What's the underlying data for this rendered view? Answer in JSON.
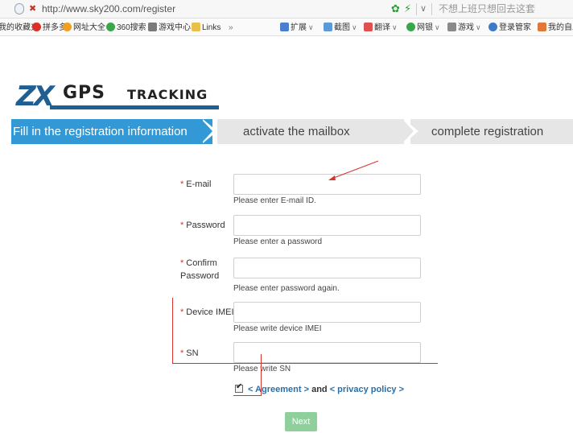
{
  "browser": {
    "url": "http://www.sky200.com/register",
    "search_text": "不想上班只想回去这套"
  },
  "favorites": [
    {
      "label": "我的收藏夹",
      "color": "#e8e8e8"
    },
    {
      "label": "拼多多",
      "color": "#e02e24"
    },
    {
      "label": "网址大全",
      "color": "#f0a020"
    },
    {
      "label": "360搜索",
      "color": "#3aa64a"
    },
    {
      "label": "游戏中心",
      "color": "#7a7a7a"
    },
    {
      "label": "Links",
      "color": "#e8c04a"
    },
    {
      "label": "»",
      "color": ""
    },
    {
      "label": "扩展",
      "color": "#4a7fd0"
    },
    {
      "label": "截图",
      "color": "#5a9ad8"
    },
    {
      "label": "翻译",
      "color": "#e05050"
    },
    {
      "label": "网银",
      "color": "#3aa64a"
    },
    {
      "label": "游戏",
      "color": "#8a8a8a"
    },
    {
      "label": "登录管家",
      "color": "#3d7ac8"
    },
    {
      "label": "我的自助",
      "color": "#e0783a"
    }
  ],
  "logo": {
    "mark": "ZX",
    "gps": "GPS",
    "tracking": "TRACKING"
  },
  "steps": {
    "step1": "Fill in the registration information",
    "step2": "activate the mailbox",
    "step3": "complete registration"
  },
  "form": {
    "required_mark": "*",
    "email_label": "E-mail",
    "email_hint": "Please enter E-mail ID.",
    "password_label": "Password",
    "password_hint": "Please enter a password",
    "confirm_label_1": "Confirm",
    "confirm_label_2": "Password",
    "confirm_hint": "Please enter password again.",
    "imei_label": "Device IMEI",
    "imei_hint": "Please write device IMEI",
    "sn_label": "SN",
    "sn_hint": "Please write SN",
    "agreement_link": "< Agreement >",
    "and_text": "and",
    "privacy_link": "< privacy policy >",
    "next_button": "Next"
  },
  "colors": {
    "step_active": "#3399d6",
    "step_inactive": "#e6e6e6",
    "required_star": "#d9332c",
    "link": "#2b6fa6",
    "next_button": "#8fcf9c",
    "annotation_red": "#d9332c"
  }
}
